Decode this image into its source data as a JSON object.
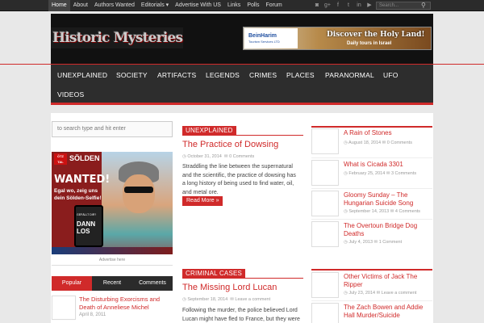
{
  "topnav": {
    "items": [
      "Home",
      "About",
      "Authors Wanted",
      "Editorials ▾",
      "Advertise With US",
      "Links",
      "Polls",
      "Forum"
    ],
    "search_placeholder": "Search..."
  },
  "header": {
    "logo_text": "Historic Mysteries",
    "ad": {
      "brand": "BeinHarim",
      "brand_sub": "Tourism Services LTD",
      "headline": "Discover the Holy Land!",
      "sub": "Daily tours in Israel"
    }
  },
  "mainnav": {
    "items": [
      "UNEXPLAINED",
      "SOCIETY",
      "ARTIFACTS",
      "LEGENDS",
      "CRIMES",
      "PLACES",
      "PARANORMAL",
      "UFO",
      "VIDEOS"
    ]
  },
  "sidebar": {
    "search_placeholder": "to search type and hit enter",
    "ad": {
      "brand_box": "ÖTZ TAL",
      "brand": "SÖLDEN",
      "wanted": "WANTED!",
      "line1": "Egal wo, zeig uns",
      "line2": "dein Sölden-Selfie!",
      "small": "GEFÄLLT DIR?",
      "dann": "DANN",
      "los": "LOS",
      "caption": "Advertise here"
    },
    "tabs": [
      "Popular",
      "Recent",
      "Comments"
    ],
    "popular": [
      {
        "title": "The Disturbing Exorcisms and Death of Anneliese Michel",
        "date": "April 8, 2011"
      }
    ]
  },
  "center": {
    "sections": [
      {
        "category": "UNEXPLAINED",
        "title": "The Practice of Dowsing",
        "date": "October 31, 2014",
        "comments": "0 Comments",
        "excerpt_lines": [
          "Straddling the line between the supernatural",
          "and the scientific, the practice of dowsing has",
          "a long history of being used to find water, oil,",
          "and metal ore."
        ],
        "read_more": "Read More »"
      },
      {
        "category": "CRIMINAL CASES",
        "title": "The Missing Lord Lucan",
        "date": "September 18, 2014",
        "comments": "Leave a comment",
        "excerpt_lines": [
          "Following the murder, the police believed Lord",
          "Lucan might have fled to France, but they were"
        ]
      }
    ]
  },
  "right": {
    "group1": [
      {
        "title_lines": [
          "A Rain of Stones"
        ],
        "date": "August 18, 2014",
        "comments": "0 Comments"
      },
      {
        "title_lines": [
          "What is Cicada 3301"
        ],
        "date": "February 25, 2014",
        "comments": "3 Comments"
      },
      {
        "title_lines": [
          "Gloomy Sunday – The",
          "Hungarian Suicide Song"
        ],
        "date": "September 14, 2013",
        "comments": "4 Comments"
      },
      {
        "title_lines": [
          "The Overtoun Bridge Dog",
          "Deaths"
        ],
        "date": "July 4, 2013",
        "comments": "1 Comment"
      }
    ],
    "group2": [
      {
        "title_lines": [
          "Other Victims of Jack The",
          "Ripper"
        ],
        "date": "July 23, 2014",
        "comments": "Leave a comment"
      },
      {
        "title_lines": [
          "The Zach Bowen and Addie",
          "Hall Murder/Suicide"
        ]
      }
    ]
  },
  "colors": {
    "accent": "#d02a2a",
    "dark": "#2d2d2d"
  }
}
